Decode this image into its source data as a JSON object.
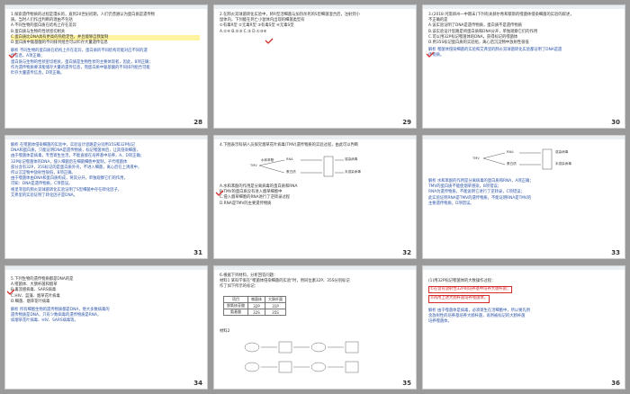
{
  "slides": [
    {
      "number": "28",
      "lines": [
        {
          "t": "1.探索遗传物质的过程是漫长的，直到20世纪初期，人们仍普遍认为蛋白质是遗传物",
          "c": ""
        },
        {
          "t": "质。当时人们作出判断的理由不包括",
          "c": ""
        },
        {
          "t": "A.不同生物的蛋白质在结构上存在差异",
          "c": ""
        },
        {
          "t": "B.蛋白质与生物的性状密切相关",
          "c": ""
        },
        {
          "t": "C.蛋白质比DNA具有更高的热稳定性，并且能够自我复制",
          "c": ""
        },
        {
          "t": "D.蛋白质中氨基酸的不同排列组合可以贮存大量遗传信息",
          "c": ""
        },
        {
          "t": "解析  不同生物的蛋白质在结构上存在差异，蛋白质的不同结构可能对应不同的遗",
          "c": "blue"
        },
        {
          "t": "传信息，A项正确；",
          "c": "blue"
        },
        {
          "t": "蛋白质与生物的性状密切相关，蛋白质是生物性状的主要体现者，因此，B项正确；",
          "c": "blue"
        },
        {
          "t": "作为遗传物质要求能储存大量的遗传信息，而蛋白质中氨基酸的不同排列组合可能",
          "c": "blue"
        },
        {
          "t": "贮存大量遗传信息，D项正确。",
          "c": "blue"
        }
      ]
    },
    {
      "number": "29",
      "lines": [
        {
          "t": "2.在肺炎双球菌转化实验中，将R型活细菌与加热杀死的S型细菌混合后，注射到小",
          "c": ""
        },
        {
          "t": "鼠体内，下列能在死亡小鼠体内出现的细菌类型有",
          "c": ""
        },
        {
          "t": "①有毒R型   ②无毒R型   ③有毒S型   ④无毒S型",
          "c": ""
        },
        {
          "t": "A.①④        B.②③        C.③          D.①③④",
          "c": ""
        }
      ]
    },
    {
      "number": "30",
      "lines": [
        {
          "t": "3.(2018·河南郑州一中期末)下列有关赫尔希和蔡斯的噬菌体侵染细菌的实验的叙述，",
          "c": ""
        },
        {
          "t": "不正确的是",
          "c": ""
        },
        {
          "t": "A.该实验证明了DNA是遗传物质，蛋白质不是遗传物质",
          "c": ""
        },
        {
          "t": "B.该实验设计思路是将蛋白质和DNA分开，单独观察它们的作用",
          "c": ""
        },
        {
          "t": "C.可以用32P标记噬菌体的DNA，获得标记的噬菌体",
          "c": ""
        },
        {
          "t": "D.用35S标记蛋白质的实验组，离心后沉淀物中放射性很低",
          "c": ""
        },
        {
          "t": "解析  噬菌体侵染细菌的实验和艾弗里的肺炎双球菌转化实验都证明了DNA是遗",
          "c": "blue"
        },
        {
          "t": "传物质。",
          "c": "blue"
        }
      ]
    },
    {
      "number": "31",
      "lines": [
        {
          "t": "解析  在噬菌体侵染细菌的实验中，实验设计思路是分别用35S和32P标记",
          "c": "blue"
        },
        {
          "t": "DNA和蛋白质，只能证明DNA是遗传物质，标记噬菌体后，让其侵染细菌，",
          "c": "blue"
        },
        {
          "t": "由于噬菌体是病毒，专营寄生生活，不能直接在培养基中培养，A、D项正确；",
          "c": "blue"
        },
        {
          "t": "32P标记噬菌体的DNA，侵入细菌后在细菌细胞中复制，子代噬菌体",
          "c": "blue"
        },
        {
          "t": "部分含有32P，35S标记的是蛋白质外壳，不进入细菌，离心后在上清液中，",
          "c": "blue"
        },
        {
          "t": "所以沉淀物中放射性很低，B项正确。",
          "c": "blue"
        },
        {
          "t": "由于噬菌体由DNA和蛋白质构成，将其分开，单独观察它们的作用，",
          "c": "blue"
        },
        {
          "t": "可知：DNA是遗传物质，C项错误。",
          "c": "blue"
        },
        {
          "t": "格里菲思的肺炎双球菌转化实验证明了S型细菌中存在转化因子，",
          "c": "blue"
        },
        {
          "t": "艾弗里的实验证明了转化因子是DNA。",
          "c": "blue"
        }
      ]
    },
    {
      "number": "32",
      "lines": [
        {
          "t": "4.下图表示科研人员探究烟草花叶病毒(TMV)遗传物质的实验过程，由此可以判断",
          "c": ""
        },
        {
          "t": "A.水和苯酚的作用是分离病毒的蛋白质和RNA",
          "c": ""
        },
        {
          "t": "B.TMV的蛋白质没有进入烟草细胞中",
          "c": ""
        },
        {
          "t": "C.侵入烟草细胞的RNA进行了逆转录过程",
          "c": ""
        },
        {
          "t": "D.RNA是TMV的主要遗传物质",
          "c": ""
        }
      ]
    },
    {
      "number": "33",
      "lines": [
        {
          "t": "解析  水和苯酚的作用是分离病毒的蛋白质和RNA，A项正确；",
          "c": "blue"
        },
        {
          "t": "TMV的蛋白质不能使烟草感染，B项错误；",
          "c": "blue"
        },
        {
          "t": "RNA为遗传物质，不能说明它进行了逆转录，C项错误；",
          "c": "blue"
        },
        {
          "t": "此实验证明RNA是TMV的遗传物质，不能证明RNA是TMV的",
          "c": "blue"
        },
        {
          "t": "主要遗传物质，D项错误。",
          "c": "blue"
        }
      ]
    },
    {
      "number": "34",
      "lines": [
        {
          "t": "5.下列生物的遗传物质都是DNA的是",
          "c": ""
        },
        {
          "t": "A.噬菌体、大肠杆菌和烟草",
          "c": ""
        },
        {
          "t": "B.禽流感病毒、SARS病毒",
          "c": ""
        },
        {
          "t": "C.HIV、蓝藻、烟草花叶病毒",
          "c": ""
        },
        {
          "t": "D.细菌、烟草花叶病毒",
          "c": ""
        },
        {
          "t": "解析  所有细胞生物的遗传物质都是DNA，绝大多数病毒的",
          "c": "blue"
        },
        {
          "t": "遗传物质是DNA，只有少数病毒的遗传物质是RNA，",
          "c": "blue"
        },
        {
          "t": "如烟草花叶病毒、HIV、SARS病毒等。",
          "c": "blue"
        }
      ]
    },
    {
      "number": "35",
      "lines": [
        {
          "t": "6.根据下列材料，分析回答问题：",
          "c": ""
        },
        {
          "t": "材料1  某科学家在\"噬菌体侵染细菌的实验\"时，用同位素32P、35S分别标记",
          "c": ""
        },
        {
          "t": "作了如下所示的标记：",
          "c": ""
        },
        {
          "t": "材料2",
          "c": ""
        }
      ],
      "table": {
        "header": [
          "项目",
          "噬菌体",
          "大肠杆菌"
        ],
        "rows": [
          [
            "脱氧核苷酸",
            "32P",
            "31P"
          ],
          [
            "氨基酸",
            "32S",
            "35S"
          ]
        ]
      }
    },
    {
      "number": "36",
      "lines": [
        {
          "t": "(1)用32P标记噬菌体的大致操作过程：",
          "c": ""
        },
        {
          "t": "①在含有放射性32P的培养基中培养大肠杆菌；",
          "c": "red"
        },
        {
          "t": "②再用上述大肠杆菌培养噬菌体。",
          "c": "red"
        },
        {
          "t": "解析  由于噬菌体是病毒，必须寄生在活细胞中，所以要先用",
          "c": "blue"
        },
        {
          "t": "含放射性的培养基培养大肠杆菌，再用被标记的大肠杆菌",
          "c": "blue"
        },
        {
          "t": "培养噬菌体。",
          "c": "blue"
        }
      ]
    }
  ],
  "diagrams": {
    "tmv_a": {
      "left": "TMV",
      "mid1": "RNA",
      "mid2": "蛋白质",
      "r1": "感染病毒",
      "r2": "未感染病毒",
      "reagent": "水和苯酚"
    },
    "tmv_b": {
      "left": "TMV",
      "mid1": "RNA",
      "mid2": "蛋白质",
      "r1": "感染病毒",
      "r2": "未感染病毒"
    }
  },
  "colors": {
    "page_bg": "#9a9a9a",
    "slide_bg": "#ffffff",
    "answer_blue": "#2b53a8",
    "highlight_red": "#d62a2a"
  }
}
